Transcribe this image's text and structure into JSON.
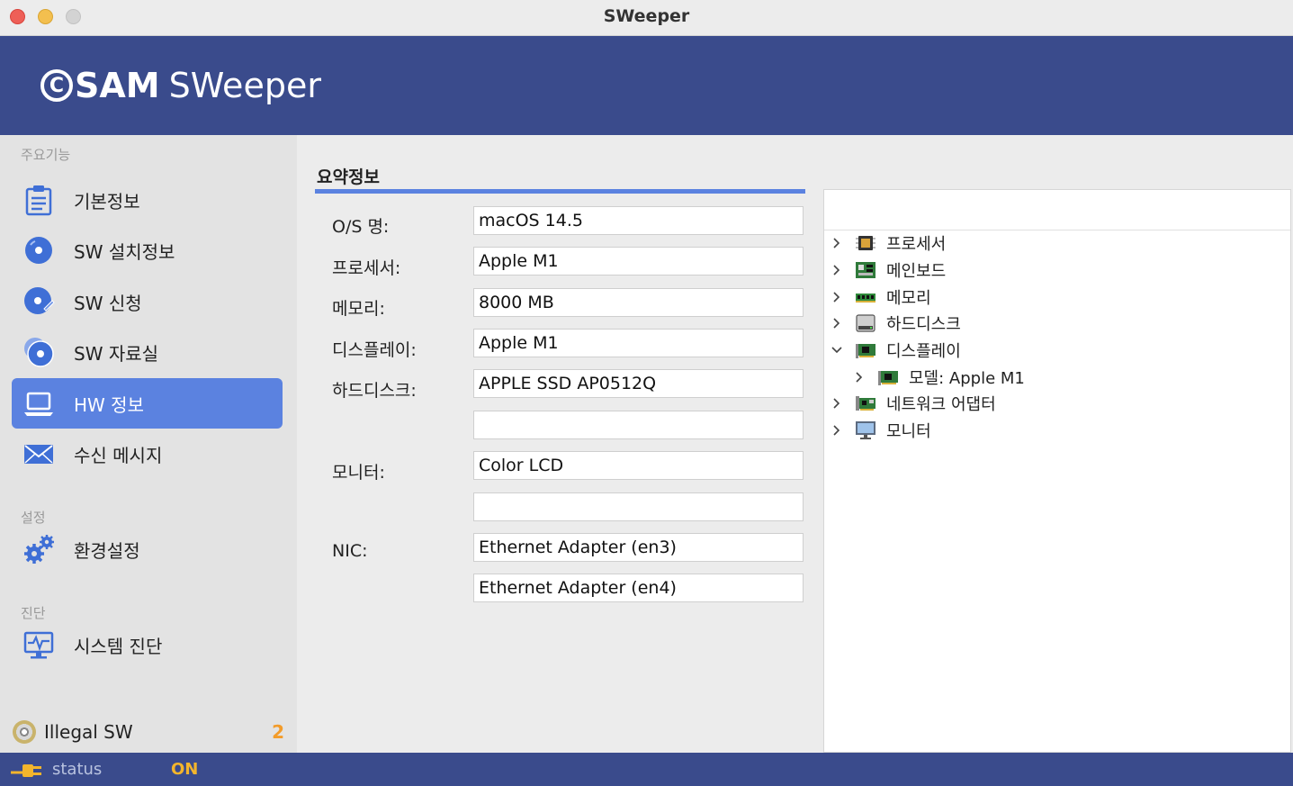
{
  "window": {
    "title": "SWeeper"
  },
  "brand": {
    "mark": "C",
    "bold": "SAM",
    "light": "SWeeper"
  },
  "sidebar": {
    "sections": {
      "main": "주요기능",
      "settings": "설정",
      "diagnosis": "진단"
    },
    "items": [
      {
        "label": "기본정보",
        "icon": "clipboard-icon",
        "active": false
      },
      {
        "label": "SW 설치정보",
        "icon": "disc-icon",
        "active": false
      },
      {
        "label": "SW 신청",
        "icon": "disc-request-icon",
        "active": false
      },
      {
        "label": "SW 자료실",
        "icon": "disc-library-icon",
        "active": false
      },
      {
        "label": "HW 정보",
        "icon": "laptop-icon",
        "active": true
      },
      {
        "label": "수신 메시지",
        "icon": "envelope-icon",
        "active": false
      },
      {
        "label": "환경설정",
        "icon": "gears-icon",
        "active": false
      },
      {
        "label": "시스템 진단",
        "icon": "monitor-pulse-icon",
        "active": false
      }
    ],
    "illegal": {
      "label": "Illegal SW",
      "count": "2"
    }
  },
  "summary": {
    "title": "요약정보",
    "fields": [
      {
        "label": "O/S 명:",
        "value": "macOS 14.5"
      },
      {
        "label": "프로세서:",
        "value": "Apple M1"
      },
      {
        "label": "메모리:",
        "value": "8000 MB"
      },
      {
        "label": "디스플레이:",
        "value": "Apple M1"
      },
      {
        "label": "하드디스크:",
        "value": "APPLE SSD AP0512Q"
      },
      {
        "label": "",
        "value": ""
      },
      {
        "label": "모니터:",
        "value": "Color LCD"
      },
      {
        "label": "",
        "value": ""
      },
      {
        "label": "NIC:",
        "value": "Ethernet Adapter (en3)"
      },
      {
        "label": "",
        "value": "Ethernet Adapter (en4)"
      }
    ]
  },
  "tree": [
    {
      "label": "프로세서",
      "icon": "cpu-icon",
      "expanded": false,
      "depth": 0
    },
    {
      "label": "메인보드",
      "icon": "mainboard-icon",
      "expanded": false,
      "depth": 0
    },
    {
      "label": "메모리",
      "icon": "ram-icon",
      "expanded": false,
      "depth": 0
    },
    {
      "label": "하드디스크",
      "icon": "harddisk-icon",
      "expanded": false,
      "depth": 0
    },
    {
      "label": "디스플레이",
      "icon": "display-card-icon",
      "expanded": true,
      "depth": 0
    },
    {
      "label": "모델: Apple M1",
      "icon": "display-card-icon",
      "expanded": false,
      "depth": 1
    },
    {
      "label": "네트워크 어댑터",
      "icon": "network-card-icon",
      "expanded": false,
      "depth": 0
    },
    {
      "label": "모니터",
      "icon": "monitor-icon",
      "expanded": false,
      "depth": 0
    }
  ],
  "status": {
    "label": "status",
    "value": "ON"
  },
  "colors": {
    "header": "#3a4b8c",
    "accent": "#5b82e0",
    "badge": "#f39c2a",
    "status_on": "#f3b52c"
  }
}
